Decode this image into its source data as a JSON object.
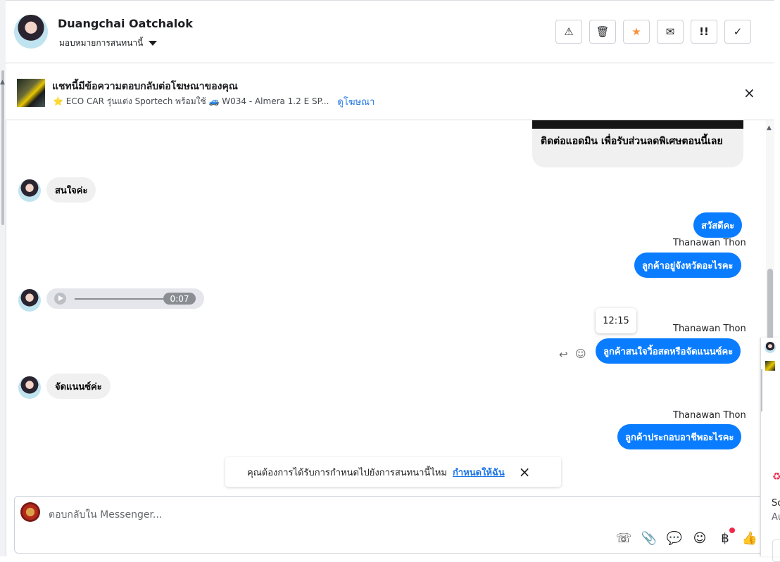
{
  "header": {
    "name": "Duangchai Oatchalok",
    "assign_label": "มอบหมายการสนทนานี้",
    "actions": [
      {
        "icon": "warning-icon",
        "glyph": "⚠"
      },
      {
        "icon": "trash-icon",
        "glyph": "🗑"
      },
      {
        "icon": "star-icon",
        "glyph": "★",
        "color": "#f7923b"
      },
      {
        "icon": "mail-icon",
        "glyph": "✉"
      },
      {
        "icon": "priority-icon",
        "glyph": "!!"
      },
      {
        "icon": "check-icon",
        "glyph": "✓"
      }
    ]
  },
  "ad": {
    "title": "แชทนี้มีข้อความตอบกลับต่อโฆษณาของคุณ",
    "subtitle": "⭐ ECO CAR รุ่นแต่ง Sportech พร้อมใช้ 🚙 W034 - Almera 1.2 E SP...",
    "link": "ดูโฆษณา",
    "close": "×"
  },
  "messages": {
    "img_caption": "ติดต่อแอดมิน เพื่อรับส่วนลดพิเศษตอนนี้เลย",
    "m1": "สนใจค่ะ",
    "m2": "สวัสดีคะ",
    "sender": "Thanawan Thon",
    "m3": "ลูกค้าอยู่จังหวัดอะไรคะ",
    "audio_duration": "0:07",
    "tooltip_time": "12:15",
    "m4": "ลูกค้าสนใจวิ้อสดหรือจัดแนนซ์คะ",
    "m5": "จัดแนนซ์ค่ะ",
    "m6": "ลูกค้าประกอบอาชีพอะไรคะ"
  },
  "toast": {
    "text": "คุณต้องการได้รับการกำหนดไปยังการสนทนานี้ไหม",
    "link": "กำหนดให้ฉัน",
    "close": "×"
  },
  "composer": {
    "placeholder": "ตอบกลับใน Messenger...",
    "icons": [
      "phone-add-icon",
      "attach-icon",
      "chat-bubble-icon",
      "emoji-icon",
      "baht-icon",
      "like-icon"
    ]
  },
  "right_panel": {
    "text1": "Sc",
    "text2": "Au"
  },
  "colors": {
    "accent": "#0a7cff",
    "link": "#1b74e4",
    "star": "#f7923b"
  }
}
